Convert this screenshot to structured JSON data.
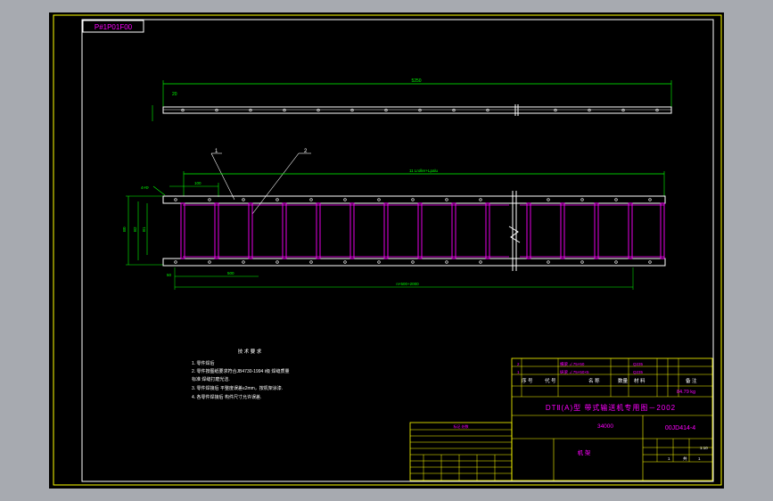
{
  "window": {
    "background": "#a7aab0",
    "canvas_background": "#000000"
  },
  "colors": {
    "frame": "#ffff00",
    "geometry": "#ffffff",
    "part": "#ff00ff",
    "dimension": "#00ff00",
    "text": "#ff00ff"
  },
  "sheet": {
    "drawing_no_box": "P#1P01F00"
  },
  "top_view": {
    "overall_length": "5250",
    "height_dim": "20"
  },
  "front_view": {
    "callouts": [
      "1",
      "2"
    ],
    "overall_length": "11 Lroller+Lpalu",
    "left_dim_a": "4×Φ",
    "left_dim_b": "100",
    "width_outer": "B0",
    "width_mid": "B2",
    "width_inner": "B1",
    "pitch_dim": "500",
    "bottom_left": "50",
    "bottom_total": "n×500+2000"
  },
  "tech_requirements": {
    "title": "技 术 要 求",
    "items": [
      "1. 零件焊后",
      "2. 零件按图纸要求符合JB4730-1994 Ⅰ级 焊缝质量",
      "   标准 焊缝打磨光洁.",
      "3. 零件焊接后 平整度误差≤2mm，按机架涂漆.",
      "4. 各零件焊接后 构件尺寸允许误差."
    ]
  },
  "change_table": {
    "title": "标记 处数",
    "rows": [
      "",
      "",
      "",
      "",
      "",
      "",
      "",
      ""
    ]
  },
  "title_block": {
    "parts_rows": [
      [
        "2",
        "横梁 ∠75×50",
        "2",
        "Q235",
        "",
        "",
        ""
      ],
      [
        "1",
        "纵梁 ∠75×50×5",
        "2",
        "Q235",
        "",
        "",
        ""
      ]
    ],
    "parts_header": [
      "序 号",
      "代 号",
      "名 称",
      "数量",
      "材 料",
      "单件",
      "总计",
      "备 注"
    ],
    "series_text": "DTⅡ(A)型 带式输送机专用图－2002",
    "mass": "84.79 kg",
    "drawing_name_label": "34000",
    "drawing_number": "00JD414-4",
    "part_name": "机 架",
    "scale": "1:10",
    "sheet_info": [
      "1",
      "共",
      "1"
    ]
  }
}
